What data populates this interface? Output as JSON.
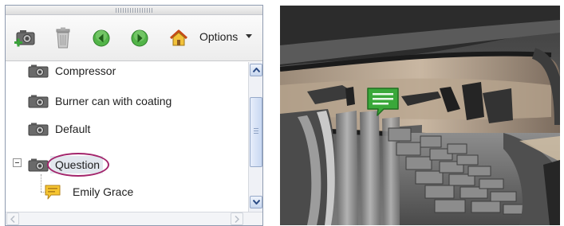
{
  "toolbar": {
    "buttons": [
      {
        "name": "add-view-button",
        "icon": "camera-add-icon"
      },
      {
        "name": "delete-button",
        "icon": "trash-icon"
      },
      {
        "name": "previous-button",
        "icon": "arrow-left-icon"
      },
      {
        "name": "next-button",
        "icon": "arrow-right-icon"
      },
      {
        "name": "home-button",
        "icon": "house-icon"
      }
    ],
    "options_label": "Options"
  },
  "tree": {
    "items": [
      {
        "label": "Compressor",
        "icon": "camera-icon"
      },
      {
        "label": "Burner can with coating",
        "icon": "camera-icon"
      },
      {
        "label": "Default",
        "icon": "camera-icon"
      },
      {
        "label": "Question",
        "icon": "camera-icon",
        "expanded": true,
        "highlighted": true
      },
      {
        "label": "Emily Grace",
        "icon": "comment-icon",
        "child": true
      }
    ]
  },
  "viewport": {
    "annotation_icon": "comment-icon",
    "colors": {
      "annotation": "#3aa83a",
      "highlight_ring": "#a3246b"
    }
  }
}
